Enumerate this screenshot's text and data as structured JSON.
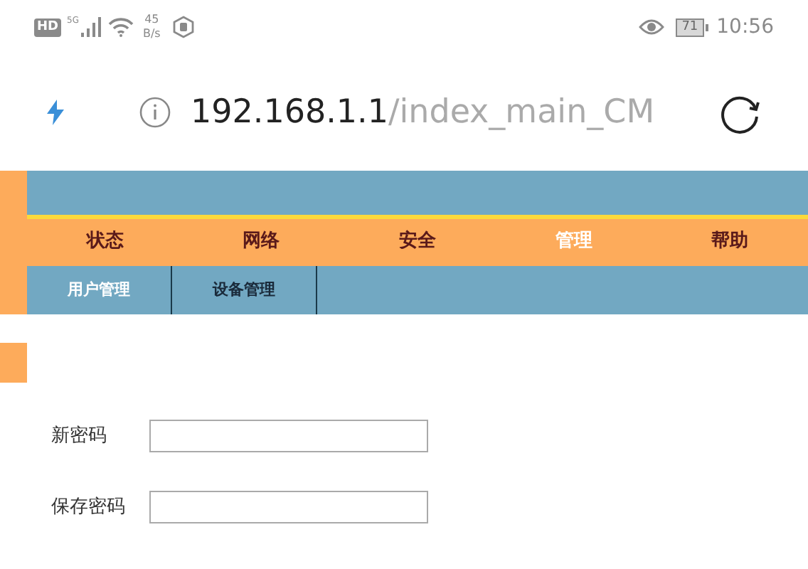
{
  "status_bar": {
    "network_badge": "HD",
    "network_type": "5G",
    "speed_value": "45",
    "speed_unit": "B/s",
    "battery": "71",
    "time": "10:56"
  },
  "address_bar": {
    "host": "192.168.1.1",
    "path": "/index_main_CM"
  },
  "menu": [
    {
      "label": "状态",
      "selected": false
    },
    {
      "label": "网络",
      "selected": false
    },
    {
      "label": "安全",
      "selected": false
    },
    {
      "label": "管理",
      "selected": true
    },
    {
      "label": "帮助",
      "selected": false
    }
  ],
  "submenu": [
    {
      "label": "用户管理",
      "selected": true
    },
    {
      "label": "设备管理",
      "selected": false
    }
  ],
  "form": [
    {
      "label": "新密码"
    },
    {
      "label": "保存密码"
    }
  ]
}
